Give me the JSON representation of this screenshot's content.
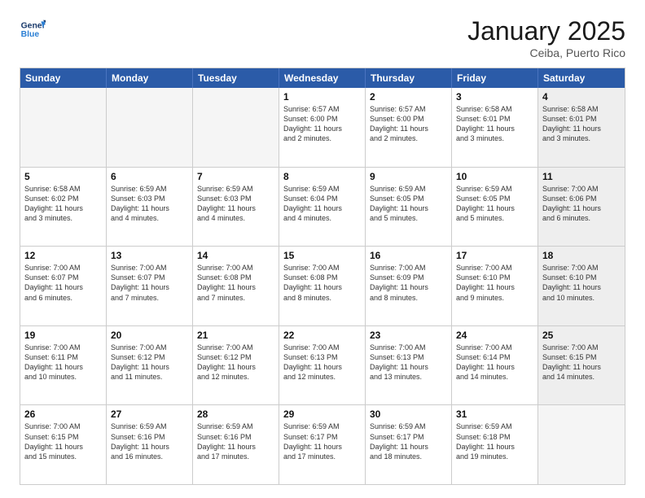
{
  "header": {
    "logo_general": "General",
    "logo_blue": "Blue",
    "month": "January 2025",
    "location": "Ceiba, Puerto Rico"
  },
  "weekdays": [
    "Sunday",
    "Monday",
    "Tuesday",
    "Wednesday",
    "Thursday",
    "Friday",
    "Saturday"
  ],
  "weeks": [
    [
      {
        "day": "",
        "info": "",
        "empty": true
      },
      {
        "day": "",
        "info": "",
        "empty": true
      },
      {
        "day": "",
        "info": "",
        "empty": true
      },
      {
        "day": "1",
        "info": "Sunrise: 6:57 AM\nSunset: 6:00 PM\nDaylight: 11 hours\nand 2 minutes.",
        "empty": false,
        "shaded": false
      },
      {
        "day": "2",
        "info": "Sunrise: 6:57 AM\nSunset: 6:00 PM\nDaylight: 11 hours\nand 2 minutes.",
        "empty": false,
        "shaded": false
      },
      {
        "day": "3",
        "info": "Sunrise: 6:58 AM\nSunset: 6:01 PM\nDaylight: 11 hours\nand 3 minutes.",
        "empty": false,
        "shaded": false
      },
      {
        "day": "4",
        "info": "Sunrise: 6:58 AM\nSunset: 6:01 PM\nDaylight: 11 hours\nand 3 minutes.",
        "empty": false,
        "shaded": true
      }
    ],
    [
      {
        "day": "5",
        "info": "Sunrise: 6:58 AM\nSunset: 6:02 PM\nDaylight: 11 hours\nand 3 minutes.",
        "empty": false,
        "shaded": false
      },
      {
        "day": "6",
        "info": "Sunrise: 6:59 AM\nSunset: 6:03 PM\nDaylight: 11 hours\nand 4 minutes.",
        "empty": false,
        "shaded": false
      },
      {
        "day": "7",
        "info": "Sunrise: 6:59 AM\nSunset: 6:03 PM\nDaylight: 11 hours\nand 4 minutes.",
        "empty": false,
        "shaded": false
      },
      {
        "day": "8",
        "info": "Sunrise: 6:59 AM\nSunset: 6:04 PM\nDaylight: 11 hours\nand 4 minutes.",
        "empty": false,
        "shaded": false
      },
      {
        "day": "9",
        "info": "Sunrise: 6:59 AM\nSunset: 6:05 PM\nDaylight: 11 hours\nand 5 minutes.",
        "empty": false,
        "shaded": false
      },
      {
        "day": "10",
        "info": "Sunrise: 6:59 AM\nSunset: 6:05 PM\nDaylight: 11 hours\nand 5 minutes.",
        "empty": false,
        "shaded": false
      },
      {
        "day": "11",
        "info": "Sunrise: 7:00 AM\nSunset: 6:06 PM\nDaylight: 11 hours\nand 6 minutes.",
        "empty": false,
        "shaded": true
      }
    ],
    [
      {
        "day": "12",
        "info": "Sunrise: 7:00 AM\nSunset: 6:07 PM\nDaylight: 11 hours\nand 6 minutes.",
        "empty": false,
        "shaded": false
      },
      {
        "day": "13",
        "info": "Sunrise: 7:00 AM\nSunset: 6:07 PM\nDaylight: 11 hours\nand 7 minutes.",
        "empty": false,
        "shaded": false
      },
      {
        "day": "14",
        "info": "Sunrise: 7:00 AM\nSunset: 6:08 PM\nDaylight: 11 hours\nand 7 minutes.",
        "empty": false,
        "shaded": false
      },
      {
        "day": "15",
        "info": "Sunrise: 7:00 AM\nSunset: 6:08 PM\nDaylight: 11 hours\nand 8 minutes.",
        "empty": false,
        "shaded": false
      },
      {
        "day": "16",
        "info": "Sunrise: 7:00 AM\nSunset: 6:09 PM\nDaylight: 11 hours\nand 8 minutes.",
        "empty": false,
        "shaded": false
      },
      {
        "day": "17",
        "info": "Sunrise: 7:00 AM\nSunset: 6:10 PM\nDaylight: 11 hours\nand 9 minutes.",
        "empty": false,
        "shaded": false
      },
      {
        "day": "18",
        "info": "Sunrise: 7:00 AM\nSunset: 6:10 PM\nDaylight: 11 hours\nand 10 minutes.",
        "empty": false,
        "shaded": true
      }
    ],
    [
      {
        "day": "19",
        "info": "Sunrise: 7:00 AM\nSunset: 6:11 PM\nDaylight: 11 hours\nand 10 minutes.",
        "empty": false,
        "shaded": false
      },
      {
        "day": "20",
        "info": "Sunrise: 7:00 AM\nSunset: 6:12 PM\nDaylight: 11 hours\nand 11 minutes.",
        "empty": false,
        "shaded": false
      },
      {
        "day": "21",
        "info": "Sunrise: 7:00 AM\nSunset: 6:12 PM\nDaylight: 11 hours\nand 12 minutes.",
        "empty": false,
        "shaded": false
      },
      {
        "day": "22",
        "info": "Sunrise: 7:00 AM\nSunset: 6:13 PM\nDaylight: 11 hours\nand 12 minutes.",
        "empty": false,
        "shaded": false
      },
      {
        "day": "23",
        "info": "Sunrise: 7:00 AM\nSunset: 6:13 PM\nDaylight: 11 hours\nand 13 minutes.",
        "empty": false,
        "shaded": false
      },
      {
        "day": "24",
        "info": "Sunrise: 7:00 AM\nSunset: 6:14 PM\nDaylight: 11 hours\nand 14 minutes.",
        "empty": false,
        "shaded": false
      },
      {
        "day": "25",
        "info": "Sunrise: 7:00 AM\nSunset: 6:15 PM\nDaylight: 11 hours\nand 14 minutes.",
        "empty": false,
        "shaded": true
      }
    ],
    [
      {
        "day": "26",
        "info": "Sunrise: 7:00 AM\nSunset: 6:15 PM\nDaylight: 11 hours\nand 15 minutes.",
        "empty": false,
        "shaded": false
      },
      {
        "day": "27",
        "info": "Sunrise: 6:59 AM\nSunset: 6:16 PM\nDaylight: 11 hours\nand 16 minutes.",
        "empty": false,
        "shaded": false
      },
      {
        "day": "28",
        "info": "Sunrise: 6:59 AM\nSunset: 6:16 PM\nDaylight: 11 hours\nand 17 minutes.",
        "empty": false,
        "shaded": false
      },
      {
        "day": "29",
        "info": "Sunrise: 6:59 AM\nSunset: 6:17 PM\nDaylight: 11 hours\nand 17 minutes.",
        "empty": false,
        "shaded": false
      },
      {
        "day": "30",
        "info": "Sunrise: 6:59 AM\nSunset: 6:17 PM\nDaylight: 11 hours\nand 18 minutes.",
        "empty": false,
        "shaded": false
      },
      {
        "day": "31",
        "info": "Sunrise: 6:59 AM\nSunset: 6:18 PM\nDaylight: 11 hours\nand 19 minutes.",
        "empty": false,
        "shaded": false
      },
      {
        "day": "",
        "info": "",
        "empty": true,
        "shaded": true
      }
    ]
  ]
}
